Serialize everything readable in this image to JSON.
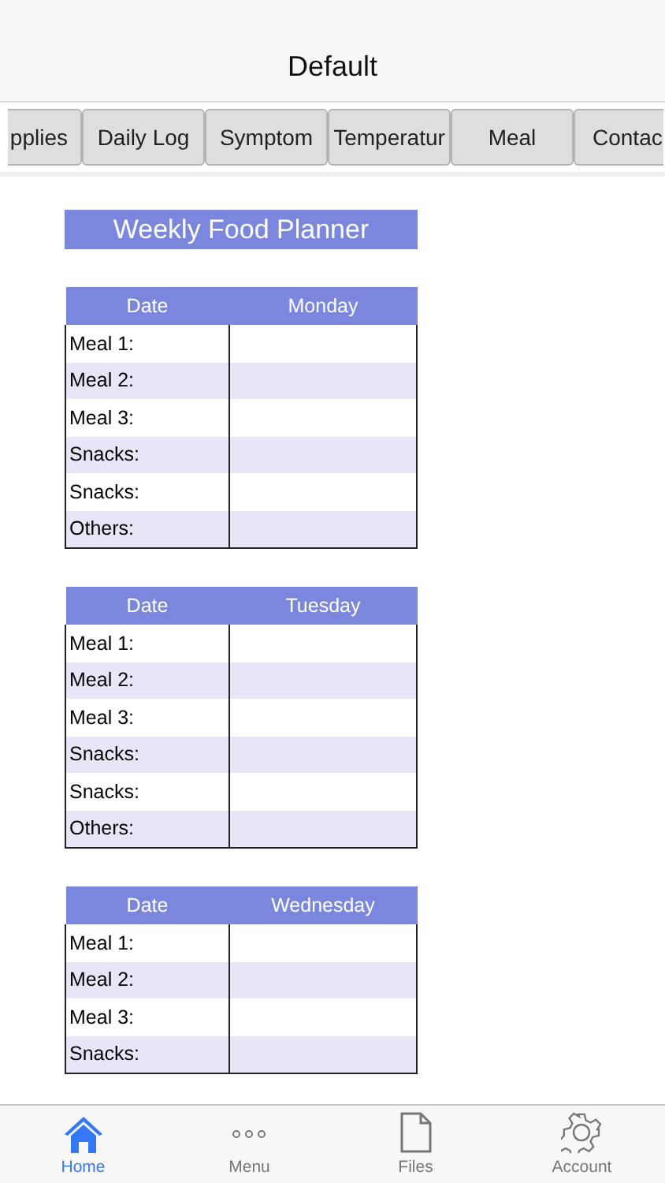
{
  "navigation_bar": {
    "title": "Default"
  },
  "tabs": [
    {
      "label": "pplies"
    },
    {
      "label": "Daily Log"
    },
    {
      "label": "Symptom"
    },
    {
      "label": "Temperatur"
    },
    {
      "label": "Meal"
    },
    {
      "label": "Contac"
    }
  ],
  "planner": {
    "title": "Weekly Food Planner",
    "tables": [
      {
        "columns": [
          "Date",
          "Monday"
        ],
        "rows": [
          "Meal 1:",
          "Meal 2:",
          "Meal 3:",
          "Snacks:",
          "Snacks:",
          "Others:"
        ]
      },
      {
        "columns": [
          "Date",
          "Tuesday"
        ],
        "rows": [
          "Meal 1:",
          "Meal 2:",
          "Meal 3:",
          "Snacks:",
          "Snacks:",
          "Others:"
        ]
      },
      {
        "columns": [
          "Date",
          "Wednesday"
        ],
        "rows": [
          "Meal 1:",
          "Meal 2:",
          "Meal 3:",
          "Snacks:"
        ]
      }
    ]
  },
  "tab_bar": [
    {
      "kind": "home",
      "label": "Home",
      "selected": true
    },
    {
      "kind": "menu",
      "label": "Menu",
      "selected": false
    },
    {
      "kind": "files",
      "label": "Files",
      "selected": false
    },
    {
      "kind": "account",
      "label": "Account",
      "selected": false
    }
  ]
}
